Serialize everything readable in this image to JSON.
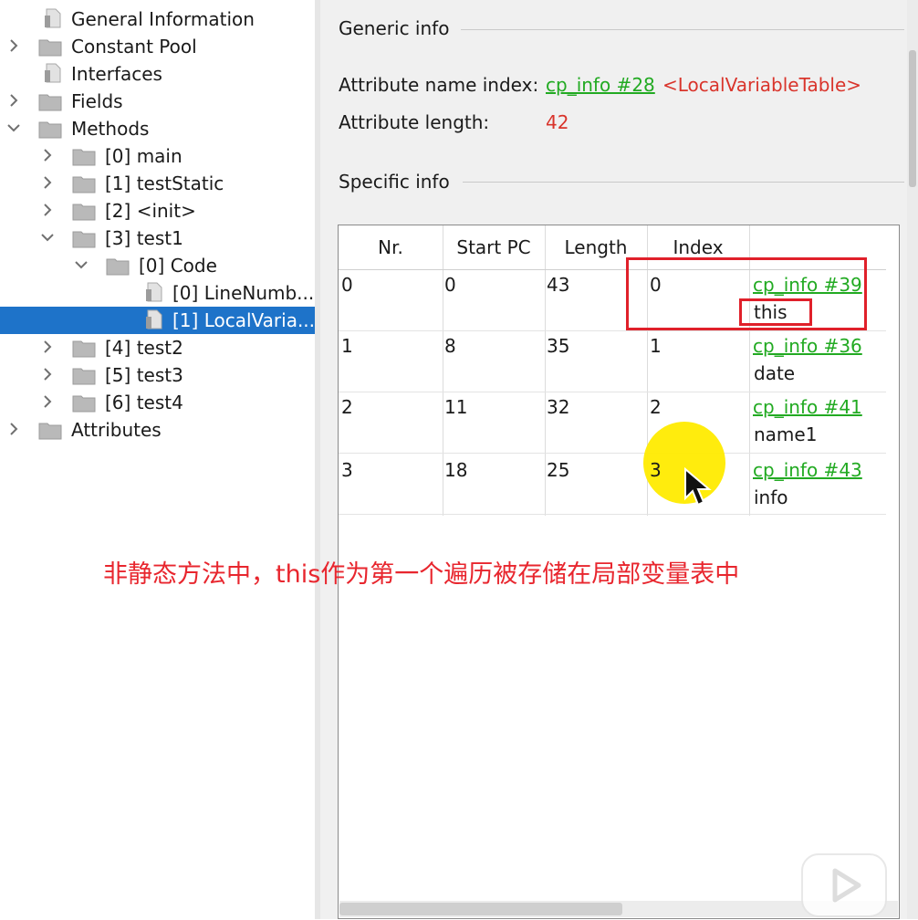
{
  "tree": {
    "items": [
      {
        "label": "General Information",
        "type": "file"
      },
      {
        "label": "Constant Pool",
        "type": "folder",
        "expand": "collapsed"
      },
      {
        "label": "Interfaces",
        "type": "file"
      },
      {
        "label": "Fields",
        "type": "folder",
        "expand": "collapsed"
      },
      {
        "label": "Methods",
        "type": "folder",
        "expand": "expanded"
      },
      {
        "label": "[0] main",
        "type": "folder",
        "expand": "collapsed"
      },
      {
        "label": "[1] testStatic",
        "type": "folder",
        "expand": "collapsed"
      },
      {
        "label": "[2] <init>",
        "type": "folder",
        "expand": "collapsed"
      },
      {
        "label": "[3] test1",
        "type": "folder",
        "expand": "expanded"
      },
      {
        "label": "[0] Code",
        "type": "folder",
        "expand": "expanded"
      },
      {
        "label": "[0] LineNumb...",
        "type": "file"
      },
      {
        "label": "[1] LocalVaria...",
        "type": "file",
        "selected": true
      },
      {
        "label": "[4] test2",
        "type": "folder",
        "expand": "collapsed"
      },
      {
        "label": "[5] test3",
        "type": "folder",
        "expand": "collapsed"
      },
      {
        "label": "[6] test4",
        "type": "folder",
        "expand": "collapsed"
      },
      {
        "label": "Attributes",
        "type": "folder",
        "expand": "collapsed"
      }
    ]
  },
  "generic": {
    "title": "Generic info",
    "name_index_label": "Attribute name index:",
    "name_index_link": "cp_info #28",
    "name_index_value": "<LocalVariableTable>",
    "length_label": "Attribute length:",
    "length_value": "42"
  },
  "specific": {
    "title": "Specific info",
    "columns": [
      "Nr.",
      "Start PC",
      "Length",
      "Index",
      ""
    ],
    "rows": [
      {
        "nr": "0",
        "start_pc": "0",
        "length": "43",
        "index": "0",
        "link": "cp_info #39",
        "name": "this"
      },
      {
        "nr": "1",
        "start_pc": "8",
        "length": "35",
        "index": "1",
        "link": "cp_info #36",
        "name": "date"
      },
      {
        "nr": "2",
        "start_pc": "11",
        "length": "32",
        "index": "2",
        "link": "cp_info #41",
        "name": "name1"
      },
      {
        "nr": "3",
        "start_pc": "18",
        "length": "25",
        "index": "3",
        "link": "cp_info #43",
        "name": "info"
      }
    ]
  },
  "annotation": {
    "caption": "非静态方法中，this作为第一个遍历被存储在局部变量表中"
  },
  "colors": {
    "selection": "#1e73c9",
    "link": "#22aa22",
    "value_red": "#d9342b",
    "annotation_red": "#e0202a",
    "highlight_yellow": "#ffeb00"
  },
  "icons": {
    "tree_folder": "folder-icon",
    "tree_file": "file-icon",
    "collapsed": "chevron-right-icon",
    "expanded": "chevron-down-icon",
    "cursor": "mouse-cursor-icon",
    "watermark": "video-play-watermark-icon"
  }
}
